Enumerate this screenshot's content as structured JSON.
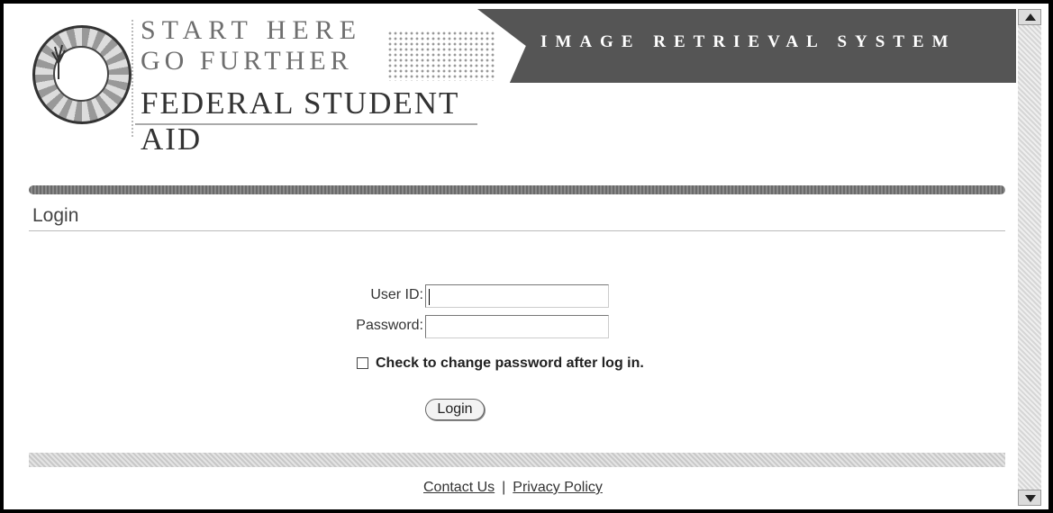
{
  "header": {
    "start_here": "START HERE",
    "go_further": "GO FURTHER",
    "agency": "FEDERAL STUDENT AID",
    "system_title": "IMAGE RETRIEVAL SYSTEM"
  },
  "page": {
    "section_title": "Login"
  },
  "form": {
    "user_id_label": "User ID:",
    "user_id_value": "",
    "password_label": "Password:",
    "password_value": "",
    "change_password_label": "Check to change password after log in.",
    "change_password_checked": false,
    "login_button": "Login"
  },
  "footer": {
    "contact_us": "Contact Us",
    "separator": "|",
    "privacy_policy": "Privacy Policy"
  },
  "icons": {
    "seal": "department-seal-icon",
    "scroll_up": "scroll-up-arrow-icon",
    "scroll_down": "scroll-down-arrow-icon"
  }
}
